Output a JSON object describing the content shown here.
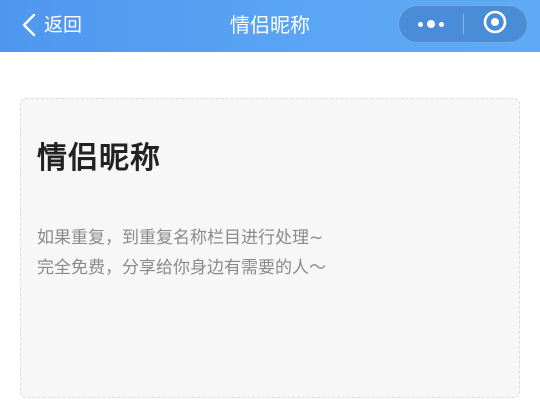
{
  "navbar": {
    "back_label": "返回",
    "title": "情侣昵称"
  },
  "card": {
    "title": "情侣昵称",
    "description_lines": [
      "如果重复，到重复名称栏目进行处理~",
      "完全免费，分享给你身边有需要的人～"
    ]
  },
  "colors": {
    "navbar_start": "#4f96f0",
    "navbar_end": "#5eaaf5",
    "card_background": "#f7f7f7",
    "title_text": "#222222",
    "description_text": "#8a8a8a"
  },
  "icons": {
    "back": "chevron-left-icon",
    "more": "more-dots-icon",
    "close": "target-circle-icon"
  }
}
